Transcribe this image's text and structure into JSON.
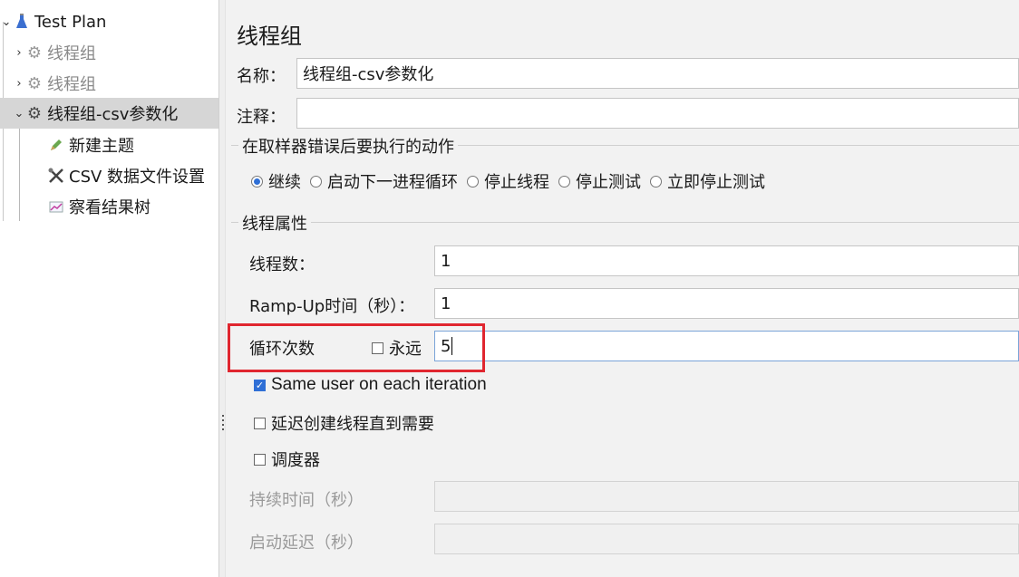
{
  "tree": {
    "root": "Test Plan",
    "items": [
      {
        "label": "线程组"
      },
      {
        "label": "线程组"
      },
      {
        "label": "线程组-csv参数化"
      },
      {
        "label": "新建主题"
      },
      {
        "label": "CSV 数据文件设置"
      },
      {
        "label": "察看结果树"
      }
    ]
  },
  "panel": {
    "title": "线程组",
    "name_label": "名称：",
    "name_value": "线程组-csv参数化",
    "comment_label": "注释：",
    "comment_value": "",
    "error_group_title": "在取样器错误后要执行的动作",
    "error_actions": [
      "继续",
      "启动下一进程循环",
      "停止线程",
      "停止测试",
      "立即停止测试"
    ],
    "error_selected": "继续",
    "thread_group_title": "线程属性",
    "threads_label": "线程数：",
    "threads_value": "1",
    "rampup_label": "Ramp-Up时间（秒）：",
    "rampup_value": "1",
    "loop_label": "循环次数",
    "forever_label": "永远",
    "forever_checked": false,
    "loop_value": "5",
    "same_user_label": "Same user on each iteration",
    "same_user_checked": true,
    "delay_label": "延迟创建线程直到需要",
    "delay_checked": false,
    "scheduler_label": "调度器",
    "scheduler_checked": false,
    "duration_label": "持续时间（秒）",
    "duration_value": "",
    "startup_delay_label": "启动延迟（秒）",
    "startup_delay_value": ""
  },
  "colors": {
    "highlight": "#e0262f",
    "accent": "#2f6fd6",
    "selected_row": "#d6d6d6"
  }
}
